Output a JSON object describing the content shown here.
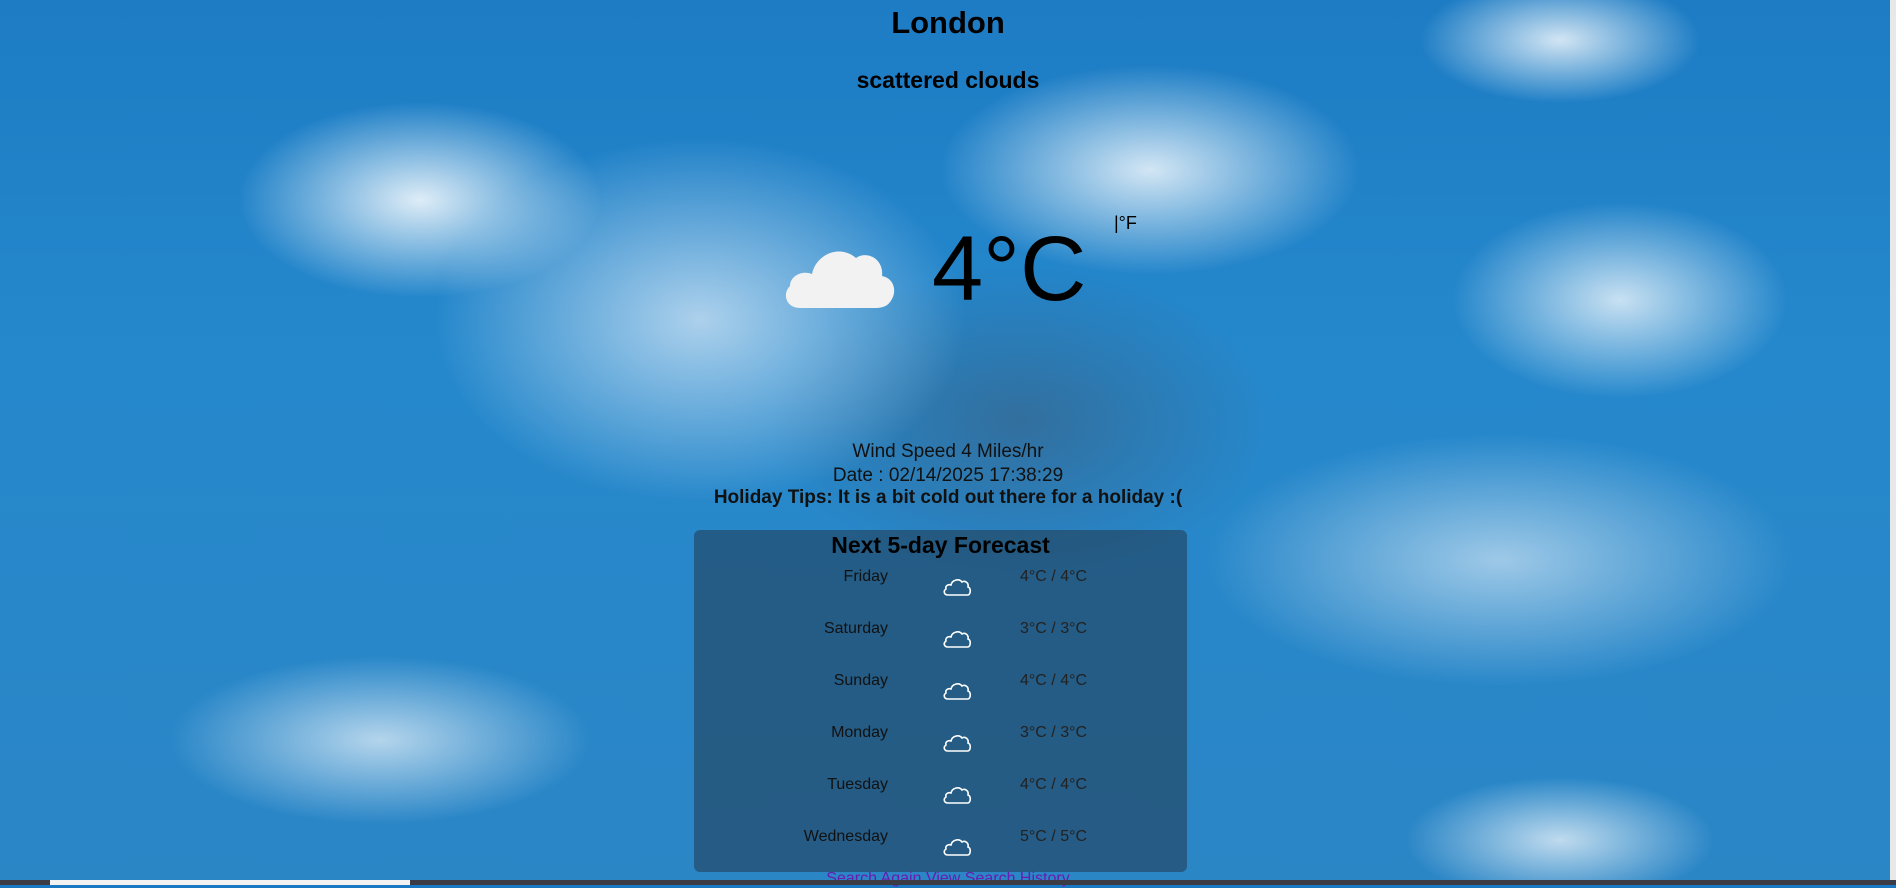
{
  "location": {
    "city": "London",
    "description": "scattered clouds"
  },
  "current": {
    "icon": "cloud-icon",
    "temperature": "4°C",
    "unit_toggle": "|°F"
  },
  "details": {
    "wind": "Wind Speed 4 Miles/hr",
    "date": "Date : 02/14/2025 17:38:29",
    "tips": "Holiday Tips: It is a bit cold out there for a holiday :("
  },
  "forecast": {
    "title": "Next 5-day Forecast",
    "days": [
      {
        "day": "Friday",
        "icon": "cloud-icon",
        "temp": "4°C / 4°C"
      },
      {
        "day": "Saturday",
        "icon": "cloud-icon",
        "temp": "3°C / 3°C"
      },
      {
        "day": "Sunday",
        "icon": "cloud-icon",
        "temp": "4°C / 4°C"
      },
      {
        "day": "Monday",
        "icon": "cloud-icon",
        "temp": "3°C / 3°C"
      },
      {
        "day": "Tuesday",
        "icon": "cloud-icon",
        "temp": "4°C / 4°C"
      },
      {
        "day": "Wednesday",
        "icon": "cloud-icon",
        "temp": "5°C / 5°C"
      }
    ]
  },
  "links": {
    "search_again": "Search Again",
    "view_history": "View Search History"
  }
}
